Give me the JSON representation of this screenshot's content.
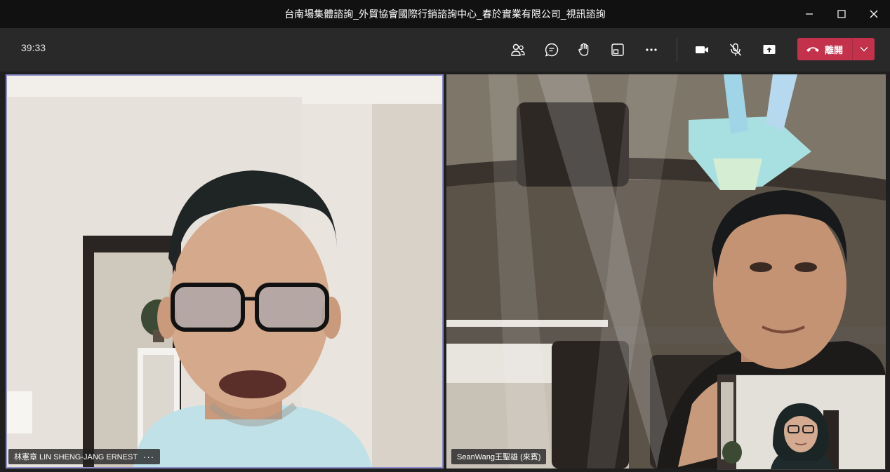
{
  "window": {
    "title": "台南場集體諮詢_外貿協會國際行銷諮詢中心_春於實業有限公司_視訊諮詢",
    "controls": [
      "minimize-icon",
      "maximize-icon",
      "close-icon"
    ]
  },
  "toolbar": {
    "timer": "39:33",
    "buttons": [
      "people-icon",
      "chat-icon",
      "raise-hand-icon",
      "breakout-rooms-icon",
      "more-options-icon",
      "camera-icon",
      "mic-off-icon",
      "share-screen-icon"
    ],
    "leave_label": "離開",
    "leave_color": "#c4314b"
  },
  "participants": [
    {
      "name": "林憲章 LIN SHENG-JANG ERNEST",
      "more": "···",
      "active_speaker": true,
      "highlight_color": "#8b8cc7"
    },
    {
      "name": "SeanWang王聖雄 (來賓)"
    }
  ]
}
